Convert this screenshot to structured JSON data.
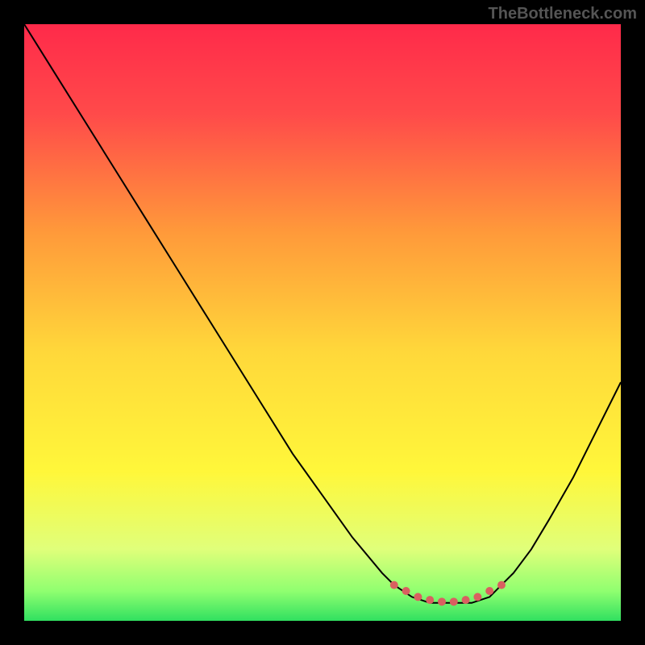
{
  "watermark": "TheBottleneck.com",
  "chart_data": {
    "type": "line",
    "title": "",
    "xlabel": "",
    "ylabel": "",
    "xlim": [
      0,
      100
    ],
    "ylim": [
      0,
      100
    ],
    "series": [
      {
        "name": "bottleneck-curve",
        "x": [
          0,
          5,
          10,
          15,
          20,
          25,
          30,
          35,
          40,
          45,
          50,
          55,
          60,
          62,
          65,
          68,
          72,
          75,
          78,
          80,
          82,
          85,
          88,
          92,
          96,
          100
        ],
        "y": [
          100,
          92,
          84,
          76,
          68,
          60,
          52,
          44,
          36,
          28,
          21,
          14,
          8,
          6,
          4,
          3,
          3,
          3,
          4,
          6,
          8,
          12,
          17,
          24,
          32,
          40
        ]
      }
    ],
    "markers": {
      "name": "optimal-range",
      "color": "#d96060",
      "points": [
        {
          "x": 62,
          "y": 6
        },
        {
          "x": 64,
          "y": 5
        },
        {
          "x": 66,
          "y": 4
        },
        {
          "x": 68,
          "y": 3.5
        },
        {
          "x": 70,
          "y": 3.2
        },
        {
          "x": 72,
          "y": 3.2
        },
        {
          "x": 74,
          "y": 3.5
        },
        {
          "x": 76,
          "y": 4
        },
        {
          "x": 78,
          "y": 5
        },
        {
          "x": 80,
          "y": 6
        }
      ]
    },
    "gradient_stops": [
      {
        "offset": 0,
        "color": "#ff2a4a"
      },
      {
        "offset": 0.15,
        "color": "#ff4a4a"
      },
      {
        "offset": 0.35,
        "color": "#ff9a3a"
      },
      {
        "offset": 0.55,
        "color": "#ffd83a"
      },
      {
        "offset": 0.75,
        "color": "#fff73a"
      },
      {
        "offset": 0.88,
        "color": "#e0ff7a"
      },
      {
        "offset": 0.95,
        "color": "#90ff70"
      },
      {
        "offset": 1.0,
        "color": "#30e060"
      }
    ]
  }
}
